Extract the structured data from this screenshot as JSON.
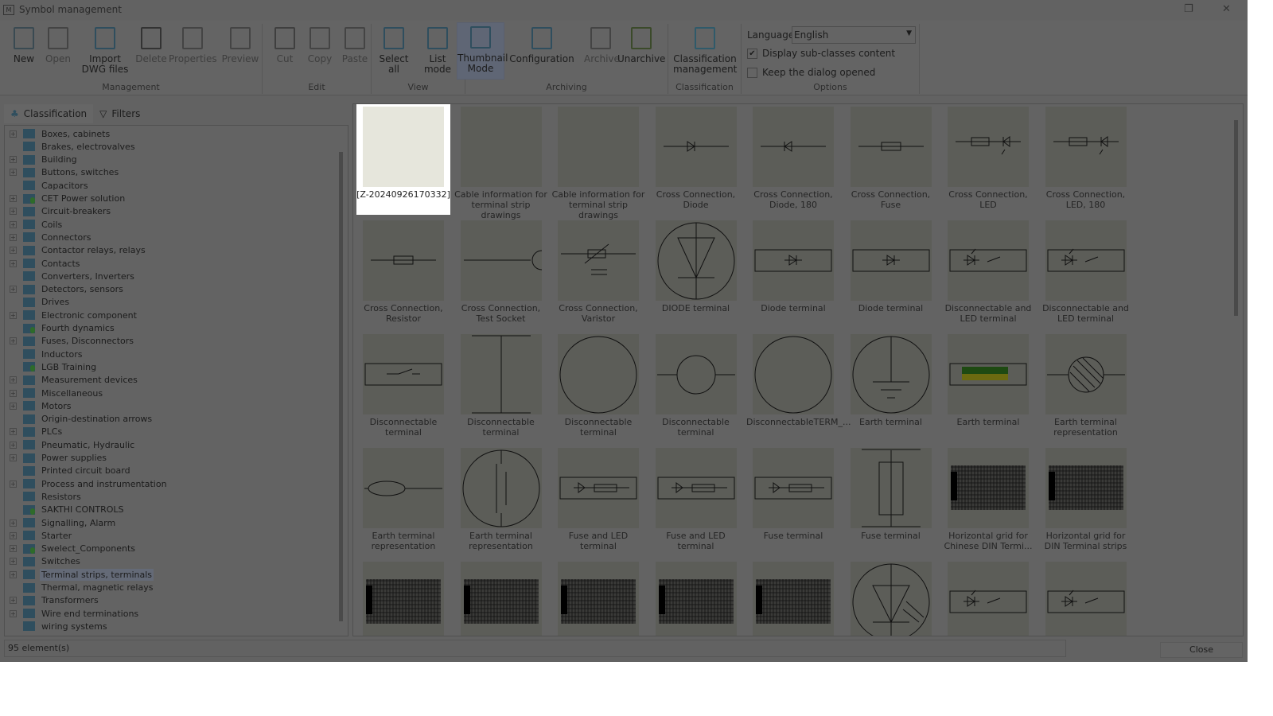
{
  "window": {
    "title": "Symbol management",
    "app_icon": "M"
  },
  "ribbon": {
    "groups": [
      {
        "label": "Management"
      },
      {
        "label": "Edit"
      },
      {
        "label": "View"
      },
      {
        "label": "Archiving"
      },
      {
        "label": "Classification"
      },
      {
        "label": "Options"
      }
    ],
    "buttons": [
      {
        "label": "New",
        "icon": "new-file-icon",
        "enabled": true
      },
      {
        "label": "Open",
        "icon": "open-folder-icon",
        "enabled": false
      },
      {
        "label": "Import DWG files",
        "icon": "import-dwg-icon",
        "enabled": true
      },
      {
        "label": "Delete",
        "icon": "delete-x-icon",
        "enabled": false
      },
      {
        "label": "Properties",
        "icon": "properties-icon",
        "enabled": false
      },
      {
        "label": "Preview",
        "icon": "preview-icon",
        "enabled": false
      },
      {
        "label": "Cut",
        "icon": "scissors-icon",
        "enabled": false
      },
      {
        "label": "Copy",
        "icon": "copy-icon",
        "enabled": false
      },
      {
        "label": "Paste",
        "icon": "paste-icon",
        "enabled": false
      },
      {
        "label": "Select all",
        "icon": "select-all-icon",
        "enabled": true
      },
      {
        "label": "List mode",
        "icon": "list-mode-icon",
        "enabled": true
      },
      {
        "label": "Thumbnail Mode",
        "icon": "thumbnail-mode-icon",
        "enabled": true,
        "selected": true
      },
      {
        "label": "Configuration",
        "icon": "configuration-gear-icon",
        "enabled": true
      },
      {
        "label": "Archive",
        "icon": "archive-icon",
        "enabled": false
      },
      {
        "label": "Unarchive",
        "icon": "unarchive-icon",
        "enabled": true
      },
      {
        "label": "Classification management",
        "icon": "hierarchy-icon",
        "enabled": true
      }
    ],
    "options": {
      "language_label": "Language",
      "language_value": "English",
      "display_subclasses": "Display sub-classes content",
      "display_subclasses_checked": true,
      "keep_open": "Keep the dialog opened",
      "keep_open_checked": false
    }
  },
  "left": {
    "tabs": [
      "Classification",
      "Filters"
    ],
    "tree": [
      {
        "label": "Boxes, cabinets",
        "exp": true
      },
      {
        "label": "Brakes, electrovalves",
        "exp": false
      },
      {
        "label": "Building",
        "exp": true
      },
      {
        "label": "Buttons, switches",
        "exp": true
      },
      {
        "label": "Capacitors",
        "exp": false
      },
      {
        "label": "CET Power solution",
        "exp": true,
        "user": true
      },
      {
        "label": "Circuit-breakers",
        "exp": true
      },
      {
        "label": "Coils",
        "exp": true
      },
      {
        "label": "Connectors",
        "exp": true
      },
      {
        "label": "Contactor relays, relays",
        "exp": true
      },
      {
        "label": "Contacts",
        "exp": true
      },
      {
        "label": "Converters, Inverters",
        "exp": false
      },
      {
        "label": "Detectors, sensors",
        "exp": true
      },
      {
        "label": "Drives",
        "exp": false
      },
      {
        "label": "Electronic component",
        "exp": true
      },
      {
        "label": "Fourth dynamics",
        "exp": false,
        "user": true
      },
      {
        "label": "Fuses, Disconnectors",
        "exp": true
      },
      {
        "label": "Inductors",
        "exp": false
      },
      {
        "label": "LGB Training",
        "exp": false,
        "user": true
      },
      {
        "label": "Measurement devices",
        "exp": true
      },
      {
        "label": "Miscellaneous",
        "exp": true
      },
      {
        "label": "Motors",
        "exp": true
      },
      {
        "label": "Origin-destination arrows",
        "exp": false
      },
      {
        "label": "PLCs",
        "exp": true
      },
      {
        "label": "Pneumatic, Hydraulic",
        "exp": true
      },
      {
        "label": "Power supplies",
        "exp": true
      },
      {
        "label": "Printed circuit board",
        "exp": false
      },
      {
        "label": "Process and instrumentation",
        "exp": true
      },
      {
        "label": "Resistors",
        "exp": false
      },
      {
        "label": "SAKTHI CONTROLS",
        "exp": false,
        "user": true
      },
      {
        "label": "Signalling, Alarm",
        "exp": true
      },
      {
        "label": "Starter",
        "exp": true
      },
      {
        "label": "Swelect_Components",
        "exp": true,
        "user": true
      },
      {
        "label": "Switches",
        "exp": true
      },
      {
        "label": "Terminal strips, terminals",
        "exp": true,
        "selected": true
      },
      {
        "label": "Thermal, magnetic relays",
        "exp": false
      },
      {
        "label": "Transformers",
        "exp": true
      },
      {
        "label": "Wire end terminations",
        "exp": true
      },
      {
        "label": "wiring systems",
        "exp": false
      }
    ]
  },
  "symbols": [
    {
      "label": "[Z-20240926170332]",
      "sym": "blank",
      "selected": true
    },
    {
      "label": "Cable information for terminal strip drawings",
      "sym": "blank"
    },
    {
      "label": "Cable information for terminal strip drawings",
      "sym": "blank"
    },
    {
      "label": "Cross Connection, Diode",
      "sym": "diode"
    },
    {
      "label": "Cross Connection, Diode, 180",
      "sym": "diode180"
    },
    {
      "label": "Cross Connection, Fuse",
      "sym": "fuse"
    },
    {
      "label": "Cross Connection, LED",
      "sym": "led"
    },
    {
      "label": "Cross Connection, LED, 180",
      "sym": "led"
    },
    {
      "label": "Cross Connection, Resistor",
      "sym": "fuse"
    },
    {
      "label": "Cross Connection, Test Socket",
      "sym": "socket"
    },
    {
      "label": "Cross Connection, Varistor",
      "sym": "varistor"
    },
    {
      "label": "DIODE terminal",
      "sym": "bigdiode"
    },
    {
      "label": "Diode terminal",
      "sym": "rectdiode"
    },
    {
      "label": "Diode terminal",
      "sym": "rectdiode"
    },
    {
      "label": "Disconnectable and LED terminal",
      "sym": "rectled"
    },
    {
      "label": "Disconnectable and LED terminal",
      "sym": "rectled"
    },
    {
      "label": "Disconnectable terminal",
      "sym": "rectswitch"
    },
    {
      "label": "Disconnectable terminal",
      "sym": "vline"
    },
    {
      "label": "Disconnectable terminal",
      "sym": "bigcircle"
    },
    {
      "label": "Disconnectable terminal",
      "sym": "smallcircle"
    },
    {
      "label": "DisconnectableTERM_...",
      "sym": "bigcircle"
    },
    {
      "label": "Earth terminal",
      "sym": "earth"
    },
    {
      "label": "Earth terminal",
      "sym": "greenyellow"
    },
    {
      "label": "Earth terminal representation",
      "sym": "hatched"
    },
    {
      "label": "Earth terminal representation",
      "sym": "ellipse"
    },
    {
      "label": "Earth terminal representation",
      "sym": "bigcap"
    },
    {
      "label": "Fuse and LED terminal",
      "sym": "rectfuse"
    },
    {
      "label": "Fuse and LED terminal",
      "sym": "rectfuse"
    },
    {
      "label": "Fuse terminal",
      "sym": "rectfuse"
    },
    {
      "label": "Fuse terminal",
      "sym": "vrect"
    },
    {
      "label": "Horizontal grid for Chinese DIN Termi...",
      "sym": "grid"
    },
    {
      "label": "Horizontal grid for DIN Terminal strips",
      "sym": "grid"
    },
    {
      "label": "",
      "sym": "grid"
    },
    {
      "label": "",
      "sym": "grid"
    },
    {
      "label": "",
      "sym": "grid"
    },
    {
      "label": "",
      "sym": "grid"
    },
    {
      "label": "",
      "sym": "grid"
    },
    {
      "label": "",
      "sym": "bigled"
    },
    {
      "label": "",
      "sym": "rectled"
    },
    {
      "label": "",
      "sym": "rectled"
    }
  ],
  "footer": {
    "status": "95 element(s)",
    "close": "Close"
  }
}
